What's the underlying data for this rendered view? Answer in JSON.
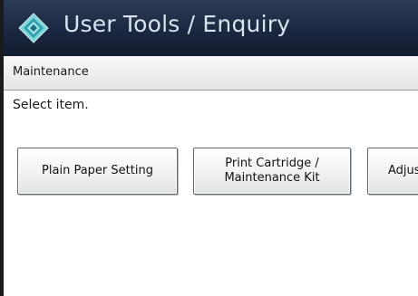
{
  "header": {
    "title": "User Tools / Enquiry",
    "logo_icon": "diamond-logo-icon"
  },
  "section": {
    "label": "Maintenance"
  },
  "instruction": "Select item.",
  "buttons": [
    {
      "label": "Plain Paper Setting"
    },
    {
      "label": "Print Cartridge /\nMaintenance Kit"
    },
    {
      "label": "Adjust"
    }
  ],
  "colors": {
    "titlebar": "#1b2740",
    "title_text": "#d9e2ee",
    "section_bar": "#eeeeee",
    "button_border": "#5d6a78"
  }
}
